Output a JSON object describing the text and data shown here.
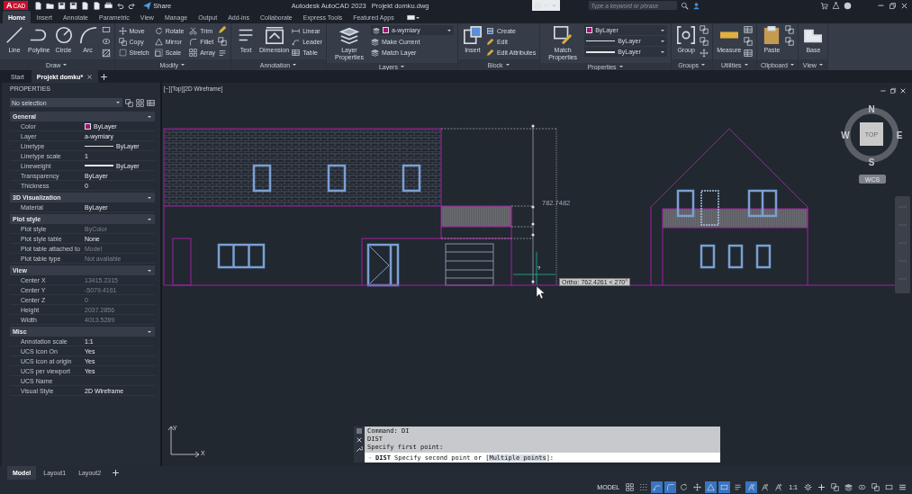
{
  "title_bar": {
    "logo_letter": "A",
    "logo_tag": "CAD",
    "share": "Share",
    "app_title": "Autodesk AutoCAD 2023",
    "file_name": "Projekt domku.dwg",
    "search": {
      "placeholder": "Type a keyword or phrase"
    }
  },
  "ribbon_tabs": [
    {
      "label": "Home",
      "selected": true
    },
    {
      "label": "Insert",
      "selected": false
    },
    {
      "label": "Annotate",
      "selected": false
    },
    {
      "label": "Parametric",
      "selected": false
    },
    {
      "label": "View",
      "selected": false
    },
    {
      "label": "Manage",
      "selected": false
    },
    {
      "label": "Output",
      "selected": false
    },
    {
      "label": "Add-ins",
      "selected": false
    },
    {
      "label": "Collaborate",
      "selected": false
    },
    {
      "label": "Express Tools",
      "selected": false
    },
    {
      "label": "Featured Apps",
      "selected": false
    }
  ],
  "ribbon_panels": [
    {
      "label": "Draw",
      "large": [
        "Line",
        "Polyline",
        "Circle",
        "Arc"
      ]
    },
    {
      "label": "Modify",
      "small": [
        "Move",
        "Copy",
        "Stretch",
        "Rotate",
        "Mirror",
        "Scale",
        "Trim",
        "Fillet",
        "Array"
      ]
    },
    {
      "label": "Annotation",
      "large": [
        "Text",
        "Dimension"
      ],
      "small": [
        "Linear",
        "Leader",
        "Table"
      ]
    },
    {
      "label": "Layers",
      "large": [
        "Layer Properties"
      ],
      "dropdowns": [
        {
          "kind": "layer",
          "value": "a-wymiary",
          "color": "#a0157a"
        }
      ],
      "small": [
        "Make Current",
        "Match Layer"
      ]
    },
    {
      "label": "Block",
      "large": [
        "Insert"
      ],
      "small": [
        "Create",
        "Edit",
        "Edit Attributes"
      ]
    },
    {
      "label": "Properties",
      "large": [
        "Match Properties"
      ],
      "dropdowns": [
        {
          "kind": "color",
          "value": "ByLayer",
          "color": "#a0157a"
        },
        {
          "kind": "linetype",
          "value": "ByLayer"
        },
        {
          "kind": "lineweight",
          "value": "ByLayer"
        }
      ]
    },
    {
      "label": "Groups",
      "large": [
        "Group"
      ]
    },
    {
      "label": "Utilities",
      "large": [
        "Measure"
      ]
    },
    {
      "label": "Clipboard",
      "large": [
        "Paste"
      ]
    },
    {
      "label": "View",
      "large": [
        "Base"
      ]
    }
  ],
  "file_tabs": [
    {
      "label": "Start",
      "selected": false
    },
    {
      "label": "Projekt domku*",
      "selected": true
    }
  ],
  "properties_panel": {
    "title": "PROPERTIES",
    "selection": "No selection",
    "sections": [
      {
        "title": "General",
        "rows": [
          {
            "label": "Color",
            "value": "ByLayer",
            "kind": "color",
            "color": "#a0157a",
            "disabled": false
          },
          {
            "label": "Layer",
            "value": "a-wymiary",
            "kind": "text",
            "disabled": false
          },
          {
            "label": "Linetype",
            "value": "ByLayer",
            "kind": "linetype",
            "disabled": false
          },
          {
            "label": "Linetype scale",
            "value": "1",
            "kind": "text",
            "disabled": false
          },
          {
            "label": "Lineweight",
            "value": "ByLayer",
            "kind": "lineweight",
            "disabled": false
          },
          {
            "label": "Transparency",
            "value": "ByLayer",
            "kind": "text",
            "disabled": false
          },
          {
            "label": "Thickness",
            "value": "0",
            "kind": "text",
            "disabled": false
          }
        ]
      },
      {
        "title": "3D Visualization",
        "rows": [
          {
            "label": "Material",
            "value": "ByLayer",
            "kind": "text",
            "disabled": false
          }
        ]
      },
      {
        "title": "Plot style",
        "rows": [
          {
            "label": "Plot style",
            "value": "ByColor",
            "kind": "text",
            "disabled": true
          },
          {
            "label": "Plot style table",
            "value": "None",
            "kind": "text",
            "disabled": false
          },
          {
            "label": "Plot table attached to",
            "value": "Model",
            "kind": "text",
            "disabled": true
          },
          {
            "label": "Plot table type",
            "value": "Not available",
            "kind": "text",
            "disabled": true
          }
        ]
      },
      {
        "title": "View",
        "rows": [
          {
            "label": "Center X",
            "value": "13415.2315",
            "kind": "text",
            "disabled": true
          },
          {
            "label": "Center Y",
            "value": "-5079.4161",
            "kind": "text",
            "disabled": true
          },
          {
            "label": "Center Z",
            "value": "0",
            "kind": "text",
            "disabled": true
          },
          {
            "label": "Height",
            "value": "2037.2856",
            "kind": "text",
            "disabled": true
          },
          {
            "label": "Width",
            "value": "4013.5289",
            "kind": "text",
            "disabled": true
          }
        ]
      },
      {
        "title": "Misc",
        "rows": [
          {
            "label": "Annotation scale",
            "value": "1:1",
            "kind": "text",
            "disabled": false
          },
          {
            "label": "UCS icon On",
            "value": "Yes",
            "kind": "text",
            "disabled": false
          },
          {
            "label": "UCS icon at origin",
            "value": "Yes",
            "kind": "text",
            "disabled": false
          },
          {
            "label": "UCS per viewport",
            "value": "Yes",
            "kind": "text",
            "disabled": false
          },
          {
            "label": "UCS Name",
            "kind": "text"
          },
          {
            "label": "Visual Style",
            "value": "2D Wireframe",
            "kind": "text",
            "disabled": false
          }
        ]
      }
    ]
  },
  "viewport": {
    "label": "[−][Top][2D Wireframe]",
    "dimension": "782.7482",
    "cursor_prompt": "?",
    "tooltip": "Ortho: 762.4261 < 270°",
    "viewcube": {
      "face": "TOP",
      "north": "N",
      "south": "S",
      "east": "E",
      "west": "W",
      "ucs_menu": "WCS"
    },
    "ucs": {
      "x": "X",
      "y": "Y"
    }
  },
  "command_line": {
    "history": [
      "Command: DI",
      "DIST",
      "Specify first point:"
    ],
    "input": {
      "command": "DIST",
      "prompt": "Specify second point or [",
      "option": "Multiple points",
      "suffix": "]:"
    }
  },
  "layout_tabs": [
    {
      "label": "Model",
      "selected": true
    },
    {
      "label": "Layout1",
      "selected": false
    },
    {
      "label": "Layout2",
      "selected": false
    }
  ],
  "status_bar": {
    "space": "MODEL",
    "scale": "1:1",
    "toggles": [
      {
        "on": false
      },
      {
        "on": false
      },
      {
        "on": true
      },
      {
        "on": true
      },
      {
        "on": false
      },
      {
        "on": false
      },
      {
        "on": true
      },
      {
        "on": true
      },
      {
        "on": false
      },
      {
        "on": true
      },
      {
        "on": false
      },
      {
        "on": false
      }
    ]
  }
}
